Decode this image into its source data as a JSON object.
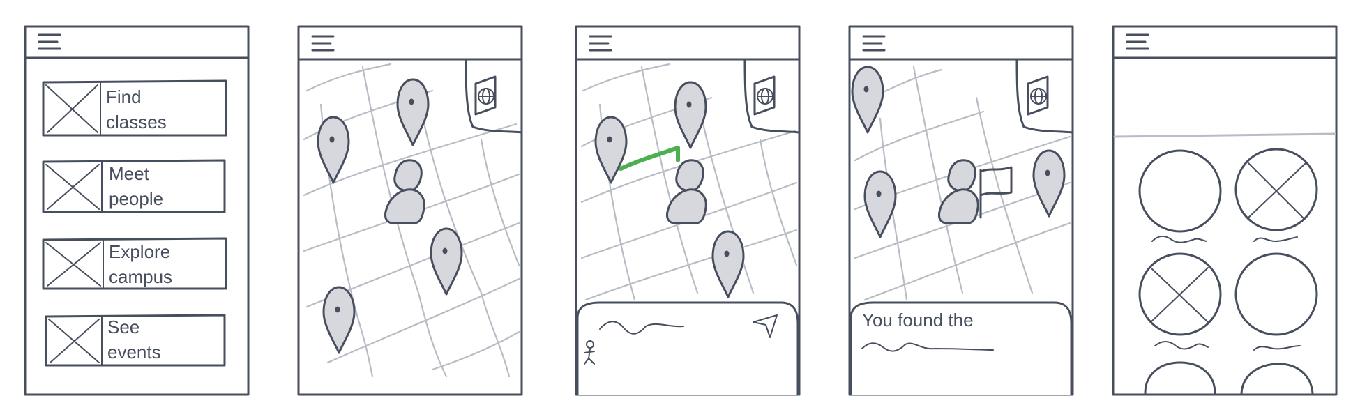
{
  "screen1": {
    "menu_items": [
      {
        "line1": "Find",
        "line2": "classes"
      },
      {
        "line1": "Meet",
        "line2": "people"
      },
      {
        "line1": "Explore",
        "line2": "campus"
      },
      {
        "line1": "See",
        "line2": "events"
      }
    ]
  },
  "screen4": {
    "found_text": "You found the"
  },
  "icons": {
    "menu": "hamburger-menu-icon",
    "map_guide": "map-guide-icon",
    "location_pin": "location-pin-icon",
    "person": "person-icon",
    "navigate": "navigation-arrow-icon",
    "walker": "walking-person-icon",
    "flag": "flag-icon",
    "placeholder_image": "image-placeholder-icon"
  },
  "colors": {
    "ink": "#474e5e",
    "map_lines": "#b9bcc5",
    "pin_fill": "#d6d8dd",
    "route": "#4caf50"
  }
}
